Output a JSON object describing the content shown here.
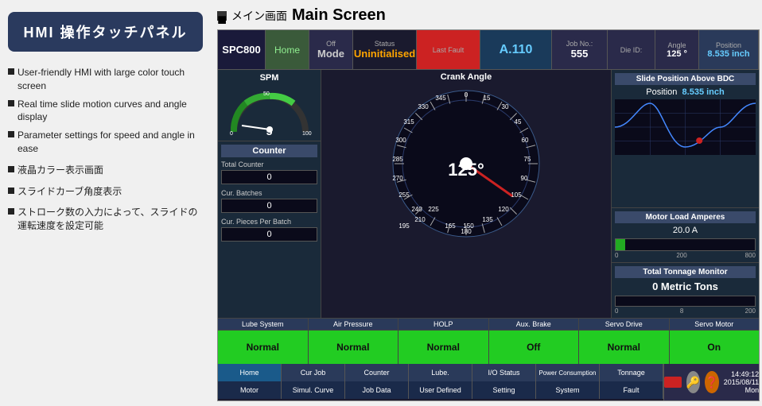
{
  "left": {
    "title": "HMI 操作タッチパネル",
    "bullets": [
      "User-friendly HMI with large color touch screen",
      "Real time slide motion curves and angle display",
      "Parameter settings for speed and angle in ease",
      "液晶カラー表示画面",
      "スライドカーブ角度表示",
      "ストローク数の入力によって、スライドの運転速度を設定可能"
    ]
  },
  "header": {
    "rect_icon": "■",
    "jp_text": "メイン画面",
    "title": "Main Screen"
  },
  "topbar": {
    "spc800": "SPC800",
    "home": "Home",
    "off": "Off",
    "mode": "Mode",
    "status_label": "Status",
    "status_value": "Uninitialised",
    "last_fault_label": "Last Fault",
    "a110": "A.110",
    "job_no_label": "Job No.:",
    "job_no": "555",
    "die_id_label": "Die ID:",
    "angle_label": "Angle",
    "angle_value": "125 °",
    "position_label": "Position",
    "position_value": "8.535 inch"
  },
  "spm": {
    "title": "SPM",
    "value": "5",
    "min": "0",
    "max": "100"
  },
  "counter": {
    "title": "Counter",
    "total_label": "Total Counter",
    "total_value": "0",
    "batches_label": "Cur. Batches",
    "batches_value": "0",
    "pieces_label": "Cur. Pieces Per Batch",
    "pieces_value": "0"
  },
  "crank": {
    "title": "Crank Angle",
    "angle": "125°"
  },
  "slide_pos": {
    "title": "Slide Position Above BDC",
    "label": "Position",
    "value": "8.535 inch"
  },
  "motor": {
    "title": "Motor Load Amperes",
    "value": "20.0 A",
    "fill_pct": 7,
    "label_0": "0",
    "label_mid": "200",
    "label_max": "800"
  },
  "tonnage": {
    "title": "Total Tonnage Monitor",
    "value": "0 Metric Tons",
    "label_0": "0",
    "label_mid": "8",
    "label_max": "200"
  },
  "status_cells": [
    {
      "title": "Lube System",
      "value": "Normal",
      "color": "green"
    },
    {
      "title": "Air Pressure",
      "value": "Normal",
      "color": "green"
    },
    {
      "title": "HOLP",
      "value": "Normal",
      "color": "green"
    },
    {
      "title": "Aux. Brake",
      "value": "Off",
      "color": "green"
    },
    {
      "title": "Servo Drive",
      "value": "Normal",
      "color": "green"
    },
    {
      "title": "Servo Motor",
      "value": "On",
      "color": "green"
    }
  ],
  "nav_row1": [
    {
      "label": "Home",
      "active": true
    },
    {
      "label": "Cur Job",
      "active": false
    },
    {
      "label": "Counter",
      "active": false
    },
    {
      "label": "Lube.",
      "active": false
    },
    {
      "label": "I/O Status",
      "active": false
    },
    {
      "label": "Power Consumption",
      "active": false
    },
    {
      "label": "Tonnage",
      "active": false
    }
  ],
  "nav_row2": [
    {
      "label": "Motor",
      "active": false
    },
    {
      "label": "Simul. Curve",
      "active": false
    },
    {
      "label": "Job Data",
      "active": false
    },
    {
      "label": "User Defined",
      "active": false
    },
    {
      "label": "Setting",
      "active": false
    },
    {
      "label": "System",
      "active": false
    },
    {
      "label": "Fault",
      "active": false
    }
  ],
  "timestamp": "14:49:12\n2015/08/11 Mon"
}
